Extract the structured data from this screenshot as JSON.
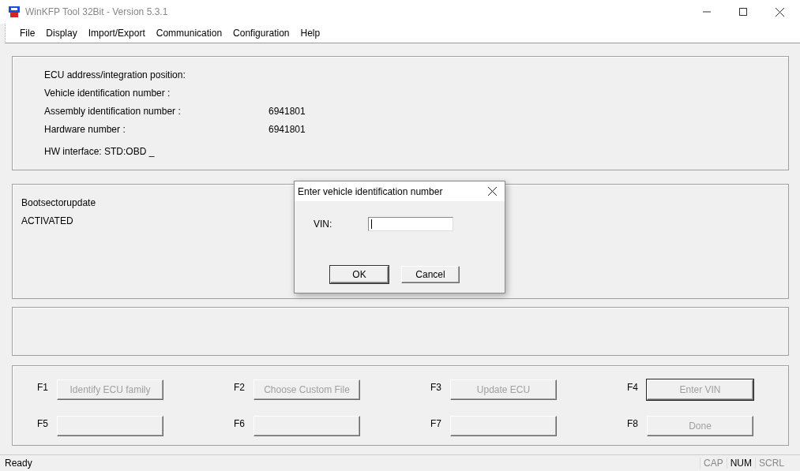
{
  "window": {
    "title": "WinKFP Tool 32Bit - Version 5.3.1"
  },
  "menu": [
    "File",
    "Display",
    "Import/Export",
    "Communication",
    "Configuration",
    "Help"
  ],
  "info": {
    "rows": [
      {
        "label": "ECU address/integration position:"
      },
      {
        "label": "Vehicle identification number :"
      },
      {
        "label": "Assembly identification number :",
        "value": "6941801"
      },
      {
        "label": "Hardware number :",
        "value": "6941801"
      }
    ],
    "interface": "HW interface:  STD:OBD _"
  },
  "status_panel": {
    "lines": [
      "Bootsectorupdate",
      "ACTIVATED"
    ]
  },
  "function_keys": [
    {
      "key": "F1",
      "label": "Identify ECU family",
      "disabled": true,
      "focused": false
    },
    {
      "key": "F2",
      "label": "Choose Custom File",
      "disabled": true,
      "focused": false
    },
    {
      "key": "F3",
      "label": "Update ECU",
      "disabled": true,
      "focused": false
    },
    {
      "key": "F4",
      "label": "Enter VIN",
      "disabled": true,
      "focused": true
    },
    {
      "key": "F5",
      "focused": false
    },
    {
      "key": "F6",
      "focused": false
    },
    {
      "key": "F7",
      "focused": false
    },
    {
      "key": "F8",
      "label": "Done",
      "disabled": true,
      "focused": false
    }
  ],
  "status_bar": {
    "text": "Ready",
    "indicators": [
      {
        "label": "CAP",
        "on": false
      },
      {
        "label": "NUM",
        "on": true
      },
      {
        "label": "SCRL",
        "on": false
      }
    ]
  },
  "dialog": {
    "title": "Enter vehicle identification number",
    "field_label": "VIN:",
    "buttons": [
      {
        "label": "OK",
        "default": true
      },
      {
        "label": "Cancel",
        "default": false
      }
    ]
  }
}
